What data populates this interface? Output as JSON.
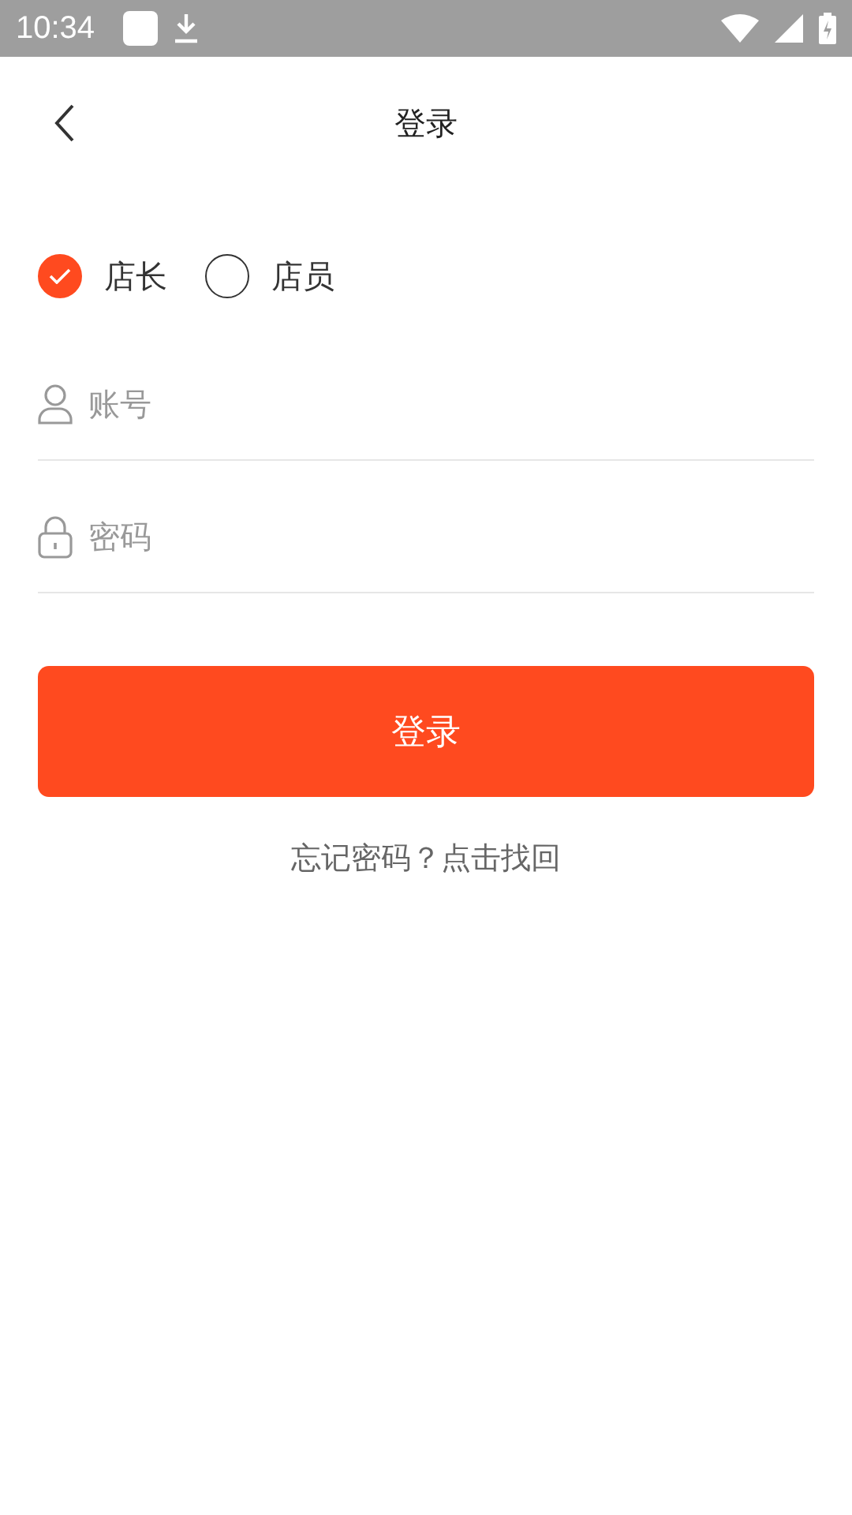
{
  "status_bar": {
    "time": "10:34"
  },
  "header": {
    "title": "登录"
  },
  "roles": [
    {
      "label": "店长",
      "selected": true
    },
    {
      "label": "店员",
      "selected": false
    }
  ],
  "fields": [
    {
      "kind": "account",
      "placeholder": "账号"
    },
    {
      "kind": "password",
      "placeholder": "密码"
    }
  ],
  "login_button": {
    "label": "登录"
  },
  "forgot_link": {
    "label": "忘记密码？点击找回"
  }
}
